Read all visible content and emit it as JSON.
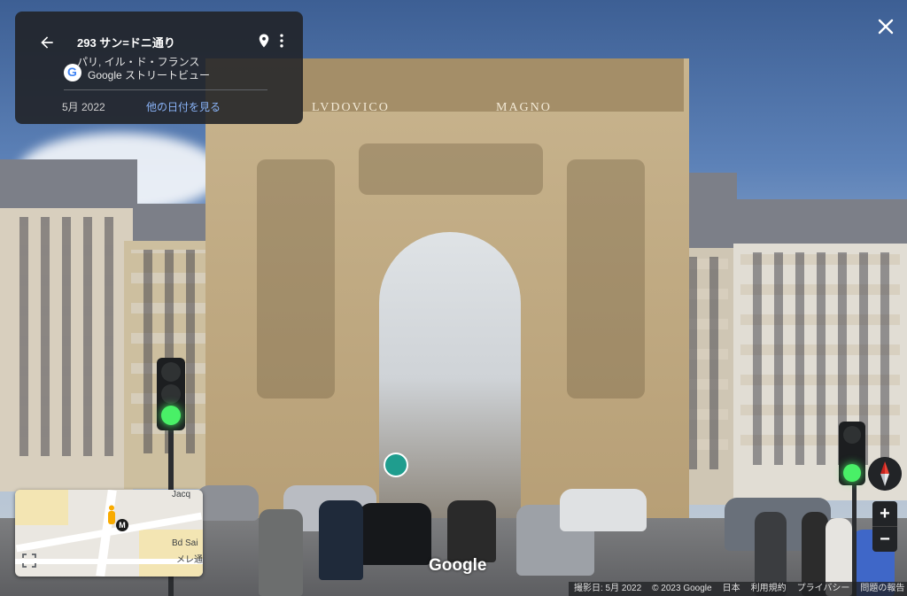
{
  "location_card": {
    "title": "293 サン=ドニ通り",
    "subtitle": "パリ, イル・ド・フランス",
    "service_label": "Google ストリートビュー",
    "capture_date": "5月 2022",
    "other_dates_link": "他の日付を見る"
  },
  "scene": {
    "inscription_left": "LVDOVICO",
    "inscription_right": "MAGNO"
  },
  "minimap": {
    "street_label_1": "Jacq",
    "street_label_2": "Bd Sai",
    "street_label_3": "メレ通",
    "metro_label": "M"
  },
  "watermark": "Google",
  "footer": {
    "capture_date": "撮影日: 5月 2022",
    "copyright": "© 2023 Google",
    "country": "日本",
    "terms": "利用規約",
    "privacy": "プライバシー",
    "report": "問題の報告"
  },
  "icons": {
    "back": "arrow-back-icon",
    "pin": "location-pin-icon",
    "more": "more-vert-icon",
    "close": "close-icon",
    "compass": "compass-icon",
    "zoom_in": "plus-icon",
    "zoom_out": "minus-icon",
    "expand": "expand-icon",
    "pegman": "pegman-icon"
  },
  "colors": {
    "card_bg": "#202124",
    "link": "#8ab4f8",
    "traffic_green": "#49f067"
  }
}
